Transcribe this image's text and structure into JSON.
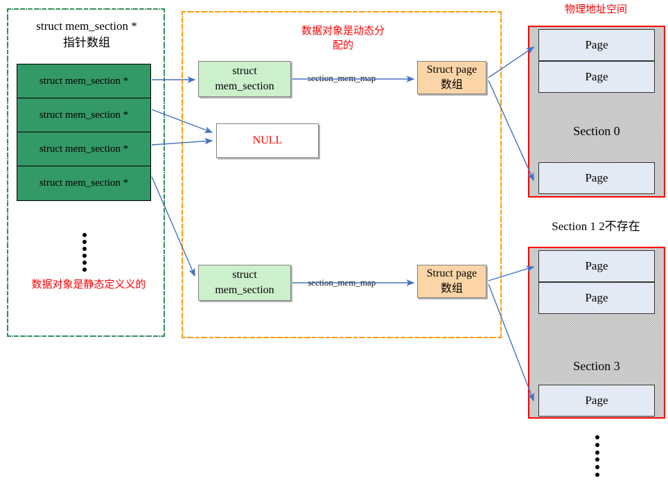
{
  "diagram": {
    "static_group": {
      "heading_line1": "struct mem_section *",
      "heading_line2": "指针数组",
      "note": "数据对象是静态定义义的",
      "array_cells": [
        "struct mem_section *",
        "struct mem_section *",
        "struct mem_section *",
        "struct mem_section *"
      ]
    },
    "dynamic_group": {
      "note_line1": "数据对象是动态分",
      "note_line2": "配的",
      "mem_section_top": {
        "line1": "struct",
        "line2": "mem_section"
      },
      "mem_section_bottom": {
        "line1": "struct",
        "line2": "mem_section"
      },
      "null_box": "NULL",
      "struct_page_top": {
        "line1": "Struct page",
        "line2": "数组"
      },
      "struct_page_bottom": {
        "line1": "Struct page",
        "line2": "数组"
      },
      "edge_label_top": "section_mem_map",
      "edge_label_bottom": "section_mem_map"
    },
    "physical_space": {
      "title": "物理地址空间",
      "missing_sections_label": "Section 1 2不存在",
      "sections": [
        {
          "name": "Section 0",
          "pages": [
            "Page",
            "Page",
            "Page"
          ]
        },
        {
          "name": "Section 3",
          "pages": [
            "Page",
            "Page",
            "Page"
          ]
        }
      ]
    },
    "colors": {
      "array_fill": "#339966",
      "mem_section_fill": "#ccf0cc",
      "struct_page_fill": "#fbd5a8",
      "section_border": "#ff0000",
      "static_frame": "#2e8b57",
      "dynamic_frame": "#ff9900",
      "arrow": "#4472c4",
      "note_text": "#ff0000"
    }
  }
}
